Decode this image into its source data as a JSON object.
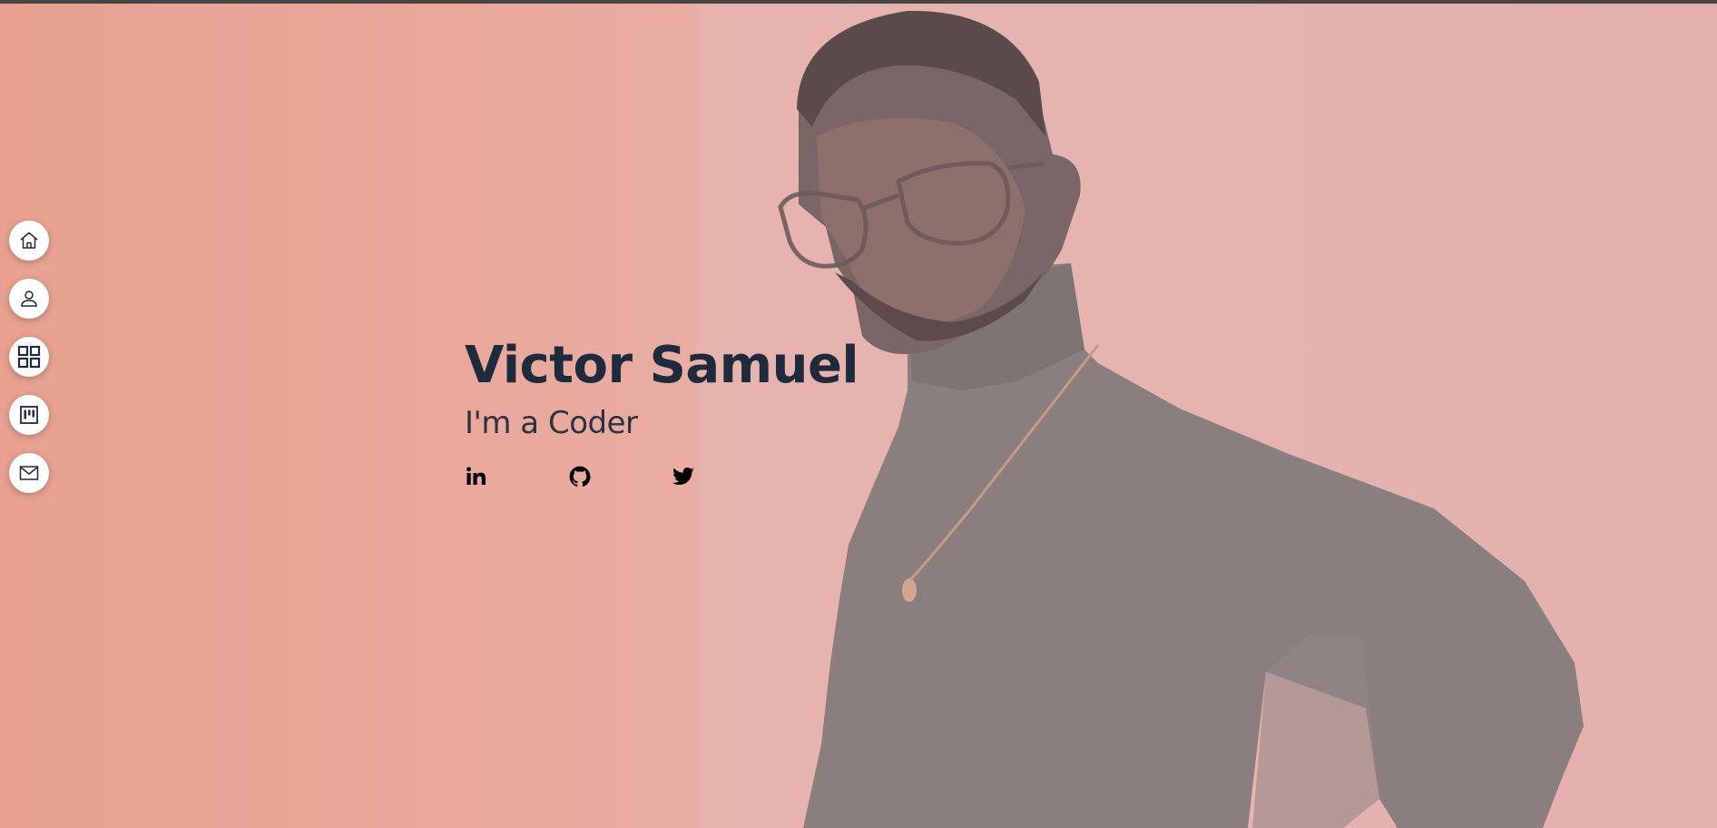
{
  "hero": {
    "name": "Victor Samuel",
    "tagline_prefix": "I'm a",
    "tagline_word": "Coder"
  },
  "nav": {
    "items": [
      {
        "icon": "home-icon"
      },
      {
        "icon": "user-icon"
      },
      {
        "icon": "grid-icon"
      },
      {
        "icon": "board-icon"
      },
      {
        "icon": "mail-icon"
      }
    ]
  },
  "socials": [
    {
      "icon": "linkedin-icon"
    },
    {
      "icon": "github-icon"
    },
    {
      "icon": "twitter-icon"
    }
  ],
  "colors": {
    "background_left": "#e8a191",
    "background_right": "#e4b3b0",
    "name_text": "#1f2a3c",
    "tagline_text": "#2b3340",
    "nav_button": "#ffffff"
  }
}
